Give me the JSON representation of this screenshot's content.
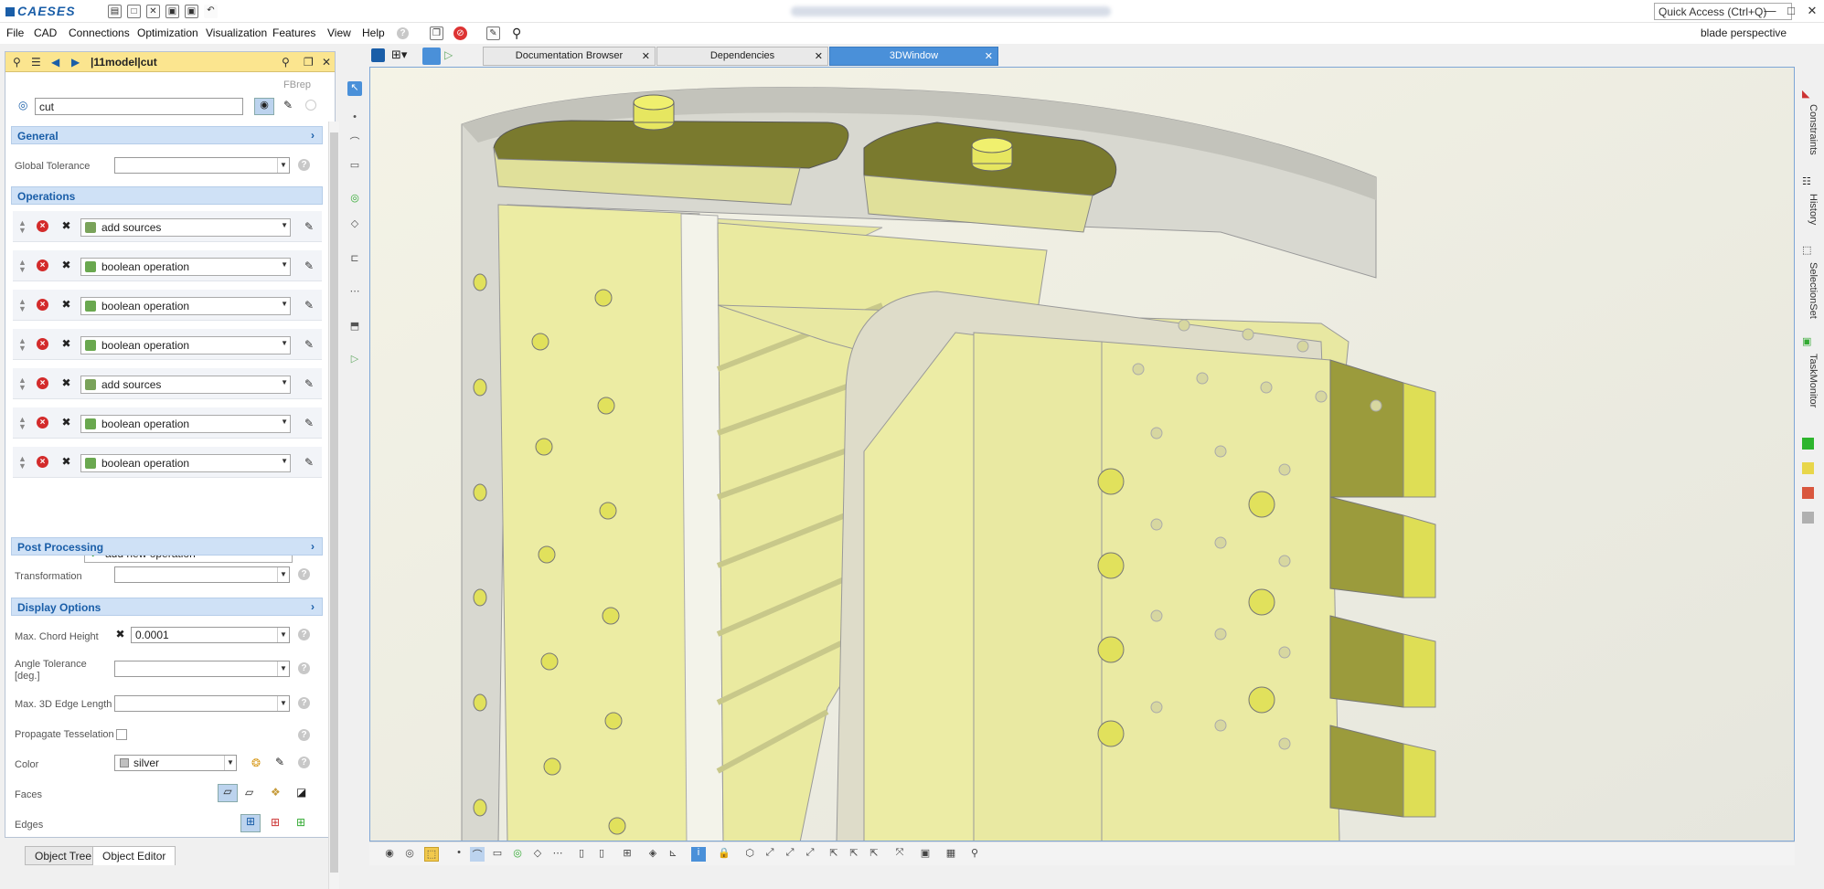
{
  "app": {
    "logo_text": "CAESES",
    "quick_access_placeholder": "Quick Access (Ctrl+Q)",
    "perspective": "blade perspective"
  },
  "menu": [
    "File",
    "CAD",
    "Connections",
    "Optimization",
    "Visualization",
    "Features",
    "View",
    "Help"
  ],
  "panel": {
    "title": "|11model|cut",
    "type_label": "FBrep",
    "name_value": "cut",
    "general": {
      "header": "General",
      "global_tolerance_label": "Global Tolerance",
      "global_tolerance_value": ""
    },
    "operations": {
      "header": "Operations",
      "items": [
        "add sources",
        "boolean operation",
        "boolean operation",
        "boolean operation",
        "add sources",
        "boolean operation",
        "boolean operation"
      ],
      "add_label": "add new operation"
    },
    "post_processing": {
      "header": "Post Processing",
      "transformation_label": "Transformation",
      "transformation_value": ""
    },
    "display": {
      "header": "Display Options",
      "chord_label": "Max. Chord Height",
      "chord_value": "0.0001",
      "angle_label": "Angle Tolerance [deg.]",
      "angle_value": "",
      "edge_label": "Max. 3D Edge Length",
      "edge_value": "",
      "propagate_label": "Propagate Tesselation",
      "color_label": "Color",
      "color_value": "silver",
      "faces_label": "Faces",
      "edges_label": "Edges"
    }
  },
  "bottom_tabs": [
    "Object Tree",
    "Object Editor"
  ],
  "doc_tabs": [
    "Documentation Browser",
    "Dependencies",
    "3DWindow"
  ],
  "right_tabs": [
    "Constraints",
    "History",
    "SelectionSet",
    "TaskMonitor"
  ],
  "status_colors": [
    "#2db52d",
    "#e8d64a",
    "#d9573e",
    "#b0b0b0"
  ]
}
